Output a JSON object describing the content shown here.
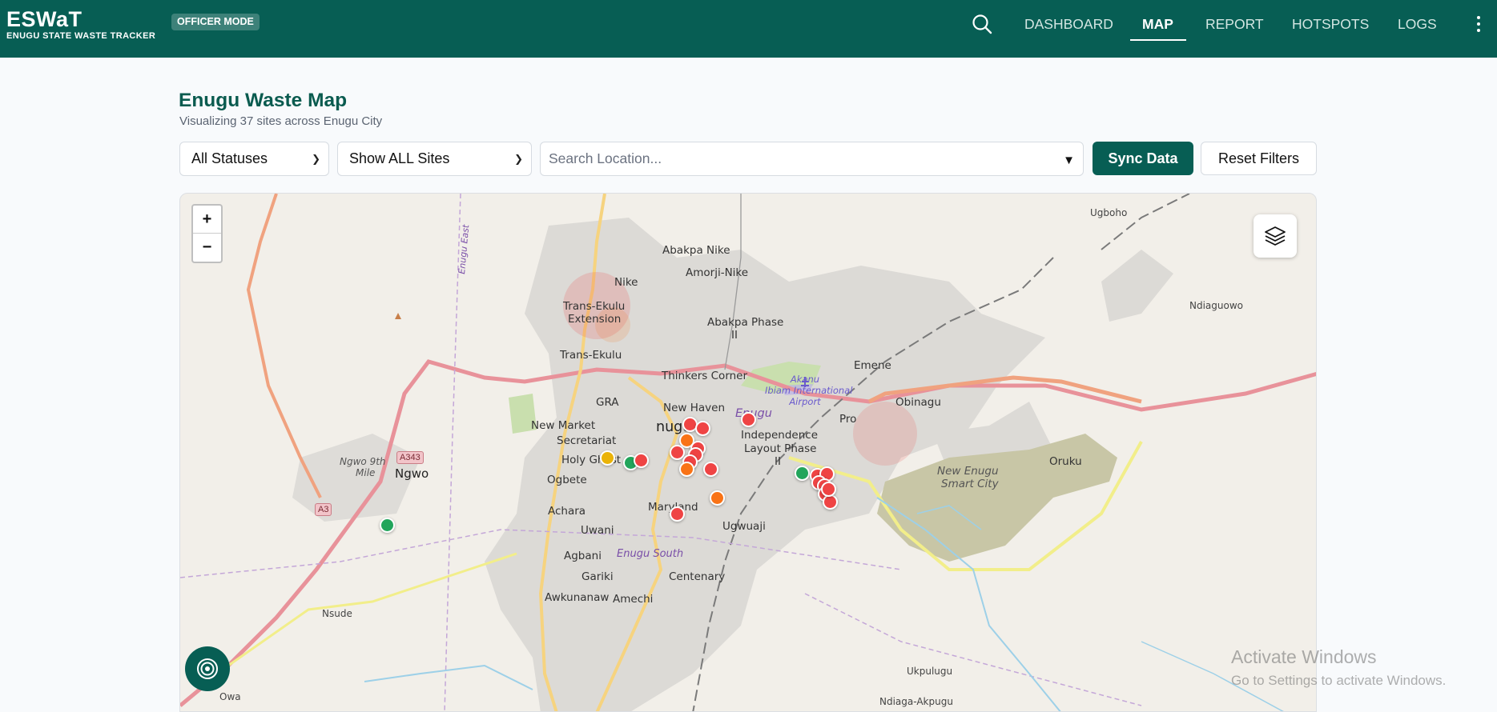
{
  "header": {
    "brand": "ESWaT",
    "brand_subtitle": "ENUGU STATE WASTE TRACKER",
    "mode_badge": "OFFICER MODE",
    "search_icon": "search-icon",
    "nav": [
      {
        "label": "DASHBOARD",
        "active": false
      },
      {
        "label": "MAP",
        "active": true
      },
      {
        "label": "REPORT",
        "active": false
      },
      {
        "label": "HOTSPOTS",
        "active": false
      },
      {
        "label": "LOGS",
        "active": false
      }
    ],
    "menu_icon": "kebab-menu-icon",
    "colors": {
      "primary": "#075e54",
      "accent": "#ffffff"
    }
  },
  "page": {
    "title": "Enugu Waste Map",
    "subtitle": "Visualizing 37 sites across Enugu City"
  },
  "filters": {
    "status_select": "All Statuses",
    "sites_select": "Show ALL Sites",
    "search_placeholder": "Search Location...",
    "sync_button": "Sync Data",
    "reset_button": "Reset Filters"
  },
  "map": {
    "zoom_in": "+",
    "zoom_out": "−",
    "layers_icon": "layers-icon",
    "locate_icon": "target-icon",
    "places": {
      "abakpa_nike": "Abakpa Nike",
      "amorji_nike": "Amorji-Nike",
      "nike": "Nike",
      "trans_ekulu_ext": "Trans-Ekulu",
      "trans_ekulu_ext2": "Extension",
      "abakpa_phase": "Abakpa Phase",
      "abakpa_phase2": "II",
      "trans_ekulu": "Trans-Ekulu",
      "thinkers_corner": "Thinkers Corner",
      "emene": "Emene",
      "airport1": "Akanu",
      "airport2": "Ibiam International",
      "airport3": "Airport",
      "gra": "GRA",
      "new_haven": "New Haven",
      "enugu_district": "Enugu",
      "obinagu": "Obinagu",
      "new_market": "New Market",
      "enugu_city": "nugu",
      "secretariat": "Secretariat",
      "independence1": "Independence",
      "independence2": "Layout Phase",
      "independence3": "II",
      "prof": "Pro",
      "holy_ghost": "Holy Ghost",
      "ogbete": "Ogbete",
      "new_enugu1": "New Enugu",
      "new_enugu2": "Smart City",
      "oruku": "Oruku",
      "achara": "Achara",
      "maryland": "Maryland",
      "ugwuaji": "Ugwuaji",
      "uwani": "Uwani",
      "agbani": "Agbani",
      "enugu_south": "Enugu South",
      "gariki": "Gariki",
      "centenary": "Centenary",
      "awkunanaw": "Awkunanaw",
      "amechi": "Amechi",
      "ngwo": "Ngwo",
      "ngwo_9th_mile1": "Ngwo 9th",
      "ngwo_9th_mile2": "Mile",
      "nsude": "Nsude",
      "owa": "Owa",
      "ugboho": "Ugboho",
      "ndiaguowo": "Ndiaguowo",
      "ukpulugu": "Ukpulugu",
      "ndiaga_akpugu": "Ndiaga-Akpugu",
      "enugu_east": "Enugu East"
    },
    "road_shields": [
      "A343",
      "A3"
    ],
    "marker_colors": {
      "critical": "#ef4444",
      "pending": "#f97316",
      "moderate": "#eab308",
      "cleared": "#22a55b"
    },
    "markers": [
      {
        "status": "critical"
      },
      {
        "status": "critical"
      },
      {
        "status": "pending"
      },
      {
        "status": "critical"
      },
      {
        "status": "critical"
      },
      {
        "status": "critical"
      },
      {
        "status": "critical"
      },
      {
        "status": "pending"
      },
      {
        "status": "critical"
      },
      {
        "status": "critical"
      },
      {
        "status": "moderate"
      },
      {
        "status": "cleared"
      },
      {
        "status": "critical"
      },
      {
        "status": "pending"
      },
      {
        "status": "critical"
      },
      {
        "status": "cleared"
      },
      {
        "status": "cleared"
      },
      {
        "status": "critical"
      },
      {
        "status": "critical"
      },
      {
        "status": "critical"
      },
      {
        "status": "critical"
      },
      {
        "status": "critical"
      },
      {
        "status": "critical"
      },
      {
        "status": "critical"
      }
    ]
  },
  "watermark": {
    "line1": "Activate Windows",
    "line2": "Go to Settings to activate Windows."
  }
}
